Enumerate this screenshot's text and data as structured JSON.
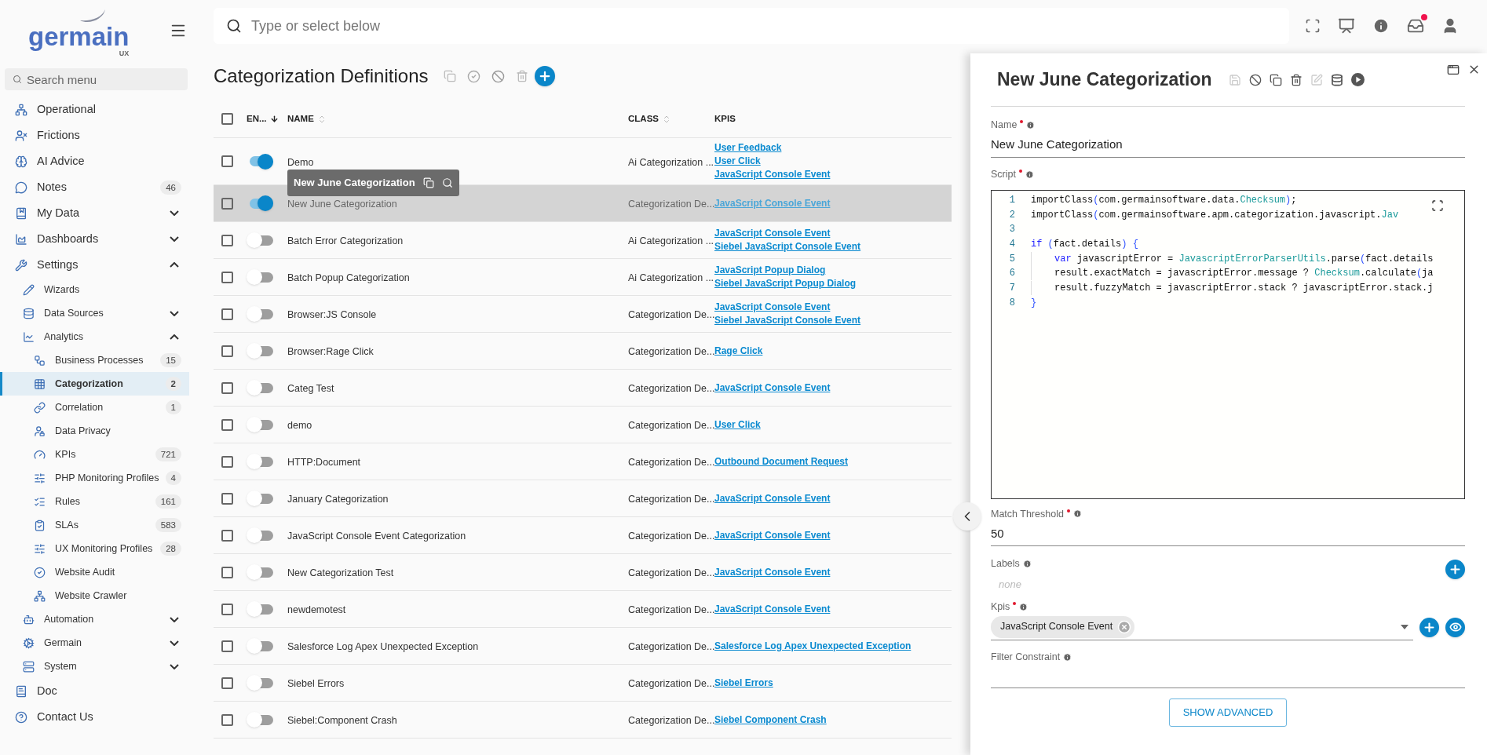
{
  "logo": {
    "name": "germain",
    "sub": "UX"
  },
  "sidebar": {
    "search": {
      "placeholder": "Search menu"
    },
    "items": [
      {
        "label": "Operational",
        "selected": false
      },
      {
        "label": "Frictions",
        "selected": false
      },
      {
        "label": "AI Advice",
        "selected": false
      },
      {
        "label": "Notes",
        "badge": "46",
        "selected": false
      },
      {
        "label": "My Data",
        "expanded": false,
        "selected": false
      },
      {
        "label": "Dashboards",
        "expanded": false,
        "selected": false
      },
      {
        "label": "Settings",
        "expanded": true,
        "selected": false,
        "children": [
          {
            "label": "Wizards",
            "selected": false
          },
          {
            "label": "Data Sources",
            "expanded": false,
            "selected": false
          },
          {
            "label": "Analytics",
            "expanded": true,
            "selected": false,
            "children": [
              {
                "label": "Business Processes",
                "badge": "15",
                "selected": false
              },
              {
                "label": "Categorization",
                "badge": "2",
                "selected": true
              },
              {
                "label": "Correlation",
                "badge": "1",
                "selected": false
              },
              {
                "label": "Data Privacy",
                "selected": false
              },
              {
                "label": "KPIs",
                "badge": "721",
                "selected": false
              },
              {
                "label": "PHP Monitoring Profiles",
                "badge": "4",
                "selected": false
              },
              {
                "label": "Rules",
                "badge": "161",
                "selected": false
              },
              {
                "label": "SLAs",
                "badge": "583",
                "selected": false
              },
              {
                "label": "UX Monitoring Profiles",
                "badge": "28",
                "selected": false
              },
              {
                "label": "Website Audit",
                "selected": false
              },
              {
                "label": "Website Crawler",
                "selected": false
              }
            ]
          },
          {
            "label": "Automation",
            "expanded": false,
            "selected": false
          },
          {
            "label": "Germain",
            "expanded": false,
            "selected": false
          },
          {
            "label": "System",
            "expanded": false,
            "selected": false
          }
        ]
      },
      {
        "label": "Doc",
        "selected": false
      },
      {
        "label": "Contact Us",
        "selected": false
      }
    ]
  },
  "topbar": {
    "search": {
      "placeholder": "Type or select below"
    },
    "notification": true
  },
  "page": {
    "title": "Categorization Definitions"
  },
  "table": {
    "all_checked": false,
    "columns": [
      {
        "label": "EN...",
        "sorted": true
      },
      {
        "label": "NAME",
        "sorted": false
      },
      {
        "label": "CLASS",
        "sorted": false
      },
      {
        "label": "KPIS"
      }
    ],
    "rows": [
      {
        "checked": false,
        "enabled": true,
        "selected": false,
        "name": "Demo",
        "class": "Ai Categorization ...",
        "kpis": [
          "User Feedback",
          "User Click",
          "JavaScript Console Event"
        ]
      },
      {
        "checked": false,
        "enabled": true,
        "selected": true,
        "name": "New June Categorization",
        "class": "Categorization De...",
        "kpis": [
          "JavaScript Console Event"
        ]
      },
      {
        "checked": false,
        "enabled": false,
        "selected": false,
        "name": "Batch Error Categorization",
        "class": "Ai Categorization ...",
        "kpis": [
          "JavaScript Console Event",
          "Siebel JavaScript Console Event"
        ]
      },
      {
        "checked": false,
        "enabled": false,
        "selected": false,
        "name": "Batch Popup Categorization",
        "class": "Ai Categorization ...",
        "kpis": [
          "JavaScript Popup Dialog",
          "Siebel JavaScript Popup Dialog"
        ]
      },
      {
        "checked": false,
        "enabled": false,
        "selected": false,
        "name": "Browser:JS Console",
        "class": "Categorization De...",
        "kpis": [
          "JavaScript Console Event",
          "Siebel JavaScript Console Event"
        ]
      },
      {
        "checked": false,
        "enabled": false,
        "selected": false,
        "name": "Browser:Rage Click",
        "class": "Categorization De...",
        "kpis": [
          "Rage Click"
        ]
      },
      {
        "checked": false,
        "enabled": false,
        "selected": false,
        "name": "Categ Test",
        "class": "Categorization De...",
        "kpis": [
          "JavaScript Console Event"
        ]
      },
      {
        "checked": false,
        "enabled": false,
        "selected": false,
        "name": "demo",
        "class": "Categorization De...",
        "kpis": [
          "User Click"
        ]
      },
      {
        "checked": false,
        "enabled": false,
        "selected": false,
        "name": "HTTP:Document",
        "class": "Categorization De...",
        "kpis": [
          "Outbound Document Request"
        ]
      },
      {
        "checked": false,
        "enabled": false,
        "selected": false,
        "name": "January Categorization",
        "class": "Categorization De...",
        "kpis": [
          "JavaScript Console Event"
        ]
      },
      {
        "checked": false,
        "enabled": false,
        "selected": false,
        "name": "JavaScript Console Event Categorization",
        "class": "Categorization De...",
        "kpis": [
          "JavaScript Console Event"
        ]
      },
      {
        "checked": false,
        "enabled": false,
        "selected": false,
        "name": "New Categorization Test",
        "class": "Categorization De...",
        "kpis": [
          "JavaScript Console Event"
        ]
      },
      {
        "checked": false,
        "enabled": false,
        "selected": false,
        "name": "newdemotest",
        "class": "Categorization De...",
        "kpis": [
          "JavaScript Console Event"
        ]
      },
      {
        "checked": false,
        "enabled": false,
        "selected": false,
        "name": "Salesforce Log Apex Unexpected Exception",
        "class": "Categorization De...",
        "kpis": [
          "Salesforce Log Apex Unexpected Exception"
        ]
      },
      {
        "checked": false,
        "enabled": false,
        "selected": false,
        "name": "Siebel Errors",
        "class": "Categorization De...",
        "kpis": [
          "Siebel Errors"
        ]
      },
      {
        "checked": false,
        "enabled": false,
        "selected": false,
        "name": "Siebel:Component Crash",
        "class": "Categorization De...",
        "kpis": [
          "Siebel Component Crash"
        ]
      }
    ]
  },
  "tooltip": {
    "text": "New June Categorization"
  },
  "panel": {
    "title": "New June Categorization",
    "name": {
      "label": "Name",
      "required": true,
      "value": "New June Categorization"
    },
    "script": {
      "label": "Script",
      "required": true,
      "lines": [
        {
          "number": "1",
          "tokens": [
            {
              "kind": "plain",
              "text": "importClass"
            },
            {
              "kind": "paren",
              "text": "("
            },
            {
              "kind": "plain",
              "text": "com.germainsoftware.data."
            },
            {
              "kind": "type",
              "text": "Checksum"
            },
            {
              "kind": "paren",
              "text": ")"
            },
            {
              "kind": "plain",
              "text": ";"
            }
          ]
        },
        {
          "number": "2",
          "tokens": [
            {
              "kind": "plain",
              "text": "importClass"
            },
            {
              "kind": "paren",
              "text": "("
            },
            {
              "kind": "plain",
              "text": "com.germainsoftware.apm.categorization.javascript."
            },
            {
              "kind": "type",
              "text": "Jav"
            }
          ]
        },
        {
          "number": "3"
        },
        {
          "number": "4",
          "tokens": [
            {
              "kind": "keyword",
              "text": "if"
            },
            {
              "kind": "paren",
              "text": " ("
            },
            {
              "kind": "plain",
              "text": "fact.details"
            },
            {
              "kind": "paren",
              "text": ") {"
            }
          ]
        },
        {
          "number": "5",
          "indent": true,
          "tokens": [
            {
              "kind": "keyword",
              "text": "var"
            },
            {
              "kind": "plain",
              "text": " javascriptError = "
            },
            {
              "kind": "type",
              "text": "JavascriptErrorParserUtils"
            },
            {
              "kind": "plain",
              "text": ".parse"
            },
            {
              "kind": "paren",
              "text": "("
            },
            {
              "kind": "plain",
              "text": "fact.details"
            }
          ]
        },
        {
          "number": "6",
          "indent": true,
          "tokens": [
            {
              "kind": "plain",
              "text": "result.exactMatch = javascriptError.message ? "
            },
            {
              "kind": "type",
              "text": "Checksum"
            },
            {
              "kind": "plain",
              "text": ".calculate"
            },
            {
              "kind": "paren",
              "text": "("
            },
            {
              "kind": "plain",
              "text": "ja"
            }
          ]
        },
        {
          "number": "7",
          "indent": true,
          "tokens": [
            {
              "kind": "plain",
              "text": "result.fuzzyMatch = javascriptError.stack ? javascriptError.stack.j"
            }
          ]
        },
        {
          "number": "8",
          "tokens": [
            {
              "kind": "paren",
              "text": "}"
            }
          ]
        }
      ]
    },
    "threshold": {
      "label": "Match Threshold",
      "required": true,
      "value": "50"
    },
    "labels": {
      "label": "Labels",
      "placeholder": "none"
    },
    "kpis": {
      "label": "Kpis",
      "required": true,
      "chips": [
        "JavaScript Console Event"
      ]
    },
    "filter": {
      "label": "Filter Constraint"
    },
    "advanced_button": "SHOW ADVANCED"
  }
}
